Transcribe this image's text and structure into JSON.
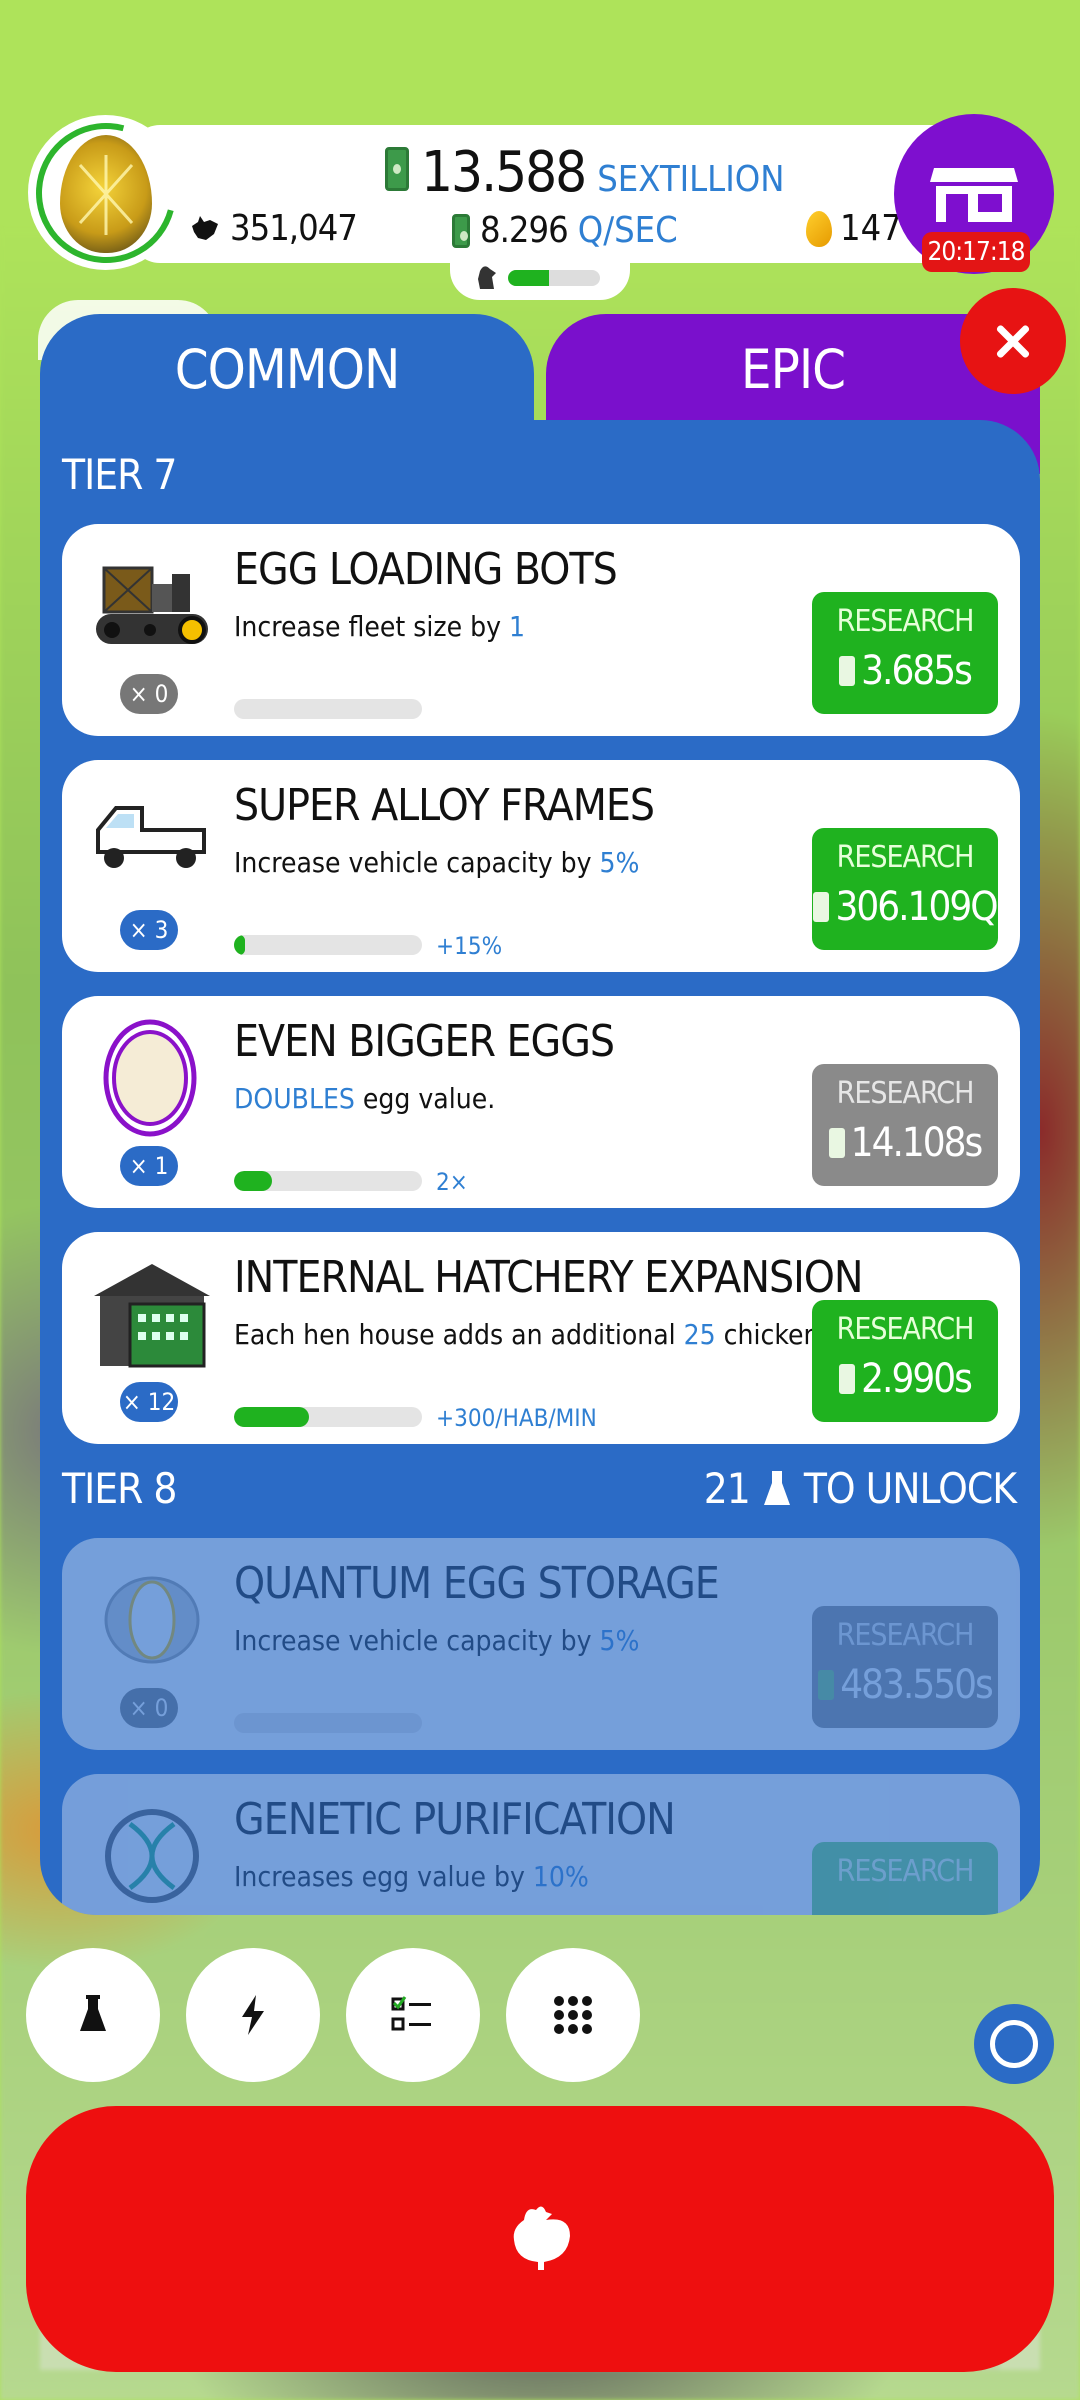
{
  "header": {
    "money_value": "13.588",
    "money_unit": "SEXTILLION",
    "rate_value": "8.296",
    "rate_unit": "Q/SEC",
    "chickens": "351,047",
    "golden_eggs": "147",
    "hatchery_fill_fraction": 0.45,
    "shop_timer": "20:17:18"
  },
  "tabs": {
    "common": "COMMON",
    "epic": "EPIC"
  },
  "tier7": {
    "label": "TIER 7",
    "cards": [
      {
        "title": "EGG LOADING BOTS",
        "desc_pre": "Increase fleet size by ",
        "desc_hl": "1",
        "desc_post": "",
        "count": "× 0",
        "progress": 0,
        "progress_label": "",
        "button_label": "RESEARCH",
        "cost": "3.685s",
        "enabled": true,
        "icon": "bulldozer-icon"
      },
      {
        "title": "SUPER ALLOY FRAMES",
        "desc_pre": "Increase vehicle capacity by ",
        "desc_hl": "5%",
        "desc_post": "",
        "count": "× 3",
        "progress": 0.06,
        "progress_label": "+15%",
        "button_label": "RESEARCH",
        "cost": "306.109Q",
        "enabled": true,
        "icon": "truck-icon"
      },
      {
        "title": "EVEN BIGGER EGGS",
        "desc_pre": "",
        "desc_hl": "DOUBLES",
        "desc_post": " egg value.",
        "count": "× 1",
        "progress": 0.2,
        "progress_label": "2×",
        "button_label": "RESEARCH",
        "cost": "14.108s",
        "enabled": false,
        "icon": "big-egg-icon"
      },
      {
        "title": "INTERNAL HATCHERY EXPANSION",
        "desc_pre": "Each hen house adds an additional ",
        "desc_hl": "25",
        "desc_post": " chickens/min",
        "count": "× 12",
        "progress": 0.4,
        "progress_label": "+300/HAB/MIN",
        "button_label": "RESEARCH",
        "cost": "2.990s",
        "enabled": true,
        "icon": "hatchery-icon"
      }
    ]
  },
  "tier8": {
    "label": "TIER 8",
    "unlock_count": "21",
    "unlock_text": "TO UNLOCK",
    "cards": [
      {
        "title": "QUANTUM EGG STORAGE",
        "desc_pre": "Increase vehicle capacity by ",
        "desc_hl": "5%",
        "desc_post": "",
        "count": "× 0",
        "button_label": "RESEARCH",
        "cost": "483.550s",
        "icon": "quantum-egg-icon"
      },
      {
        "title": "GENETIC PURIFICATION",
        "desc_pre": "Increases egg value by ",
        "desc_hl": "10%",
        "desc_post": "",
        "button_label": "RESEARCH",
        "icon": "dna-icon"
      }
    ]
  },
  "colors": {
    "accent_blue": "#2b6bc6",
    "epic_purple": "#7a10cc",
    "research_green": "#1fb21f",
    "hatch_red": "#ee0f0f"
  }
}
